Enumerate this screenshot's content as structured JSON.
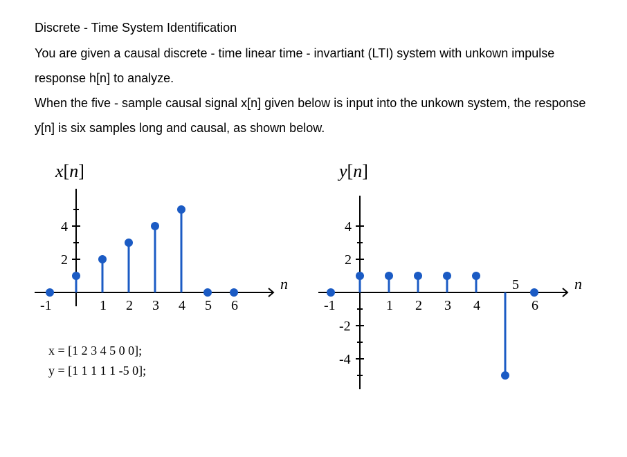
{
  "doc": {
    "title": "Discrete - Time System Identification",
    "p1": "You are given a causal discrete - time linear time - invartiant (LTI) system with unkown impulse response h[n] to analyze.",
    "p2": "When the five - sample causal signal x[n] given below is input into the unkown system, the response y[n] is six samples long and causal, as shown below."
  },
  "left_plot": {
    "label_var": "x",
    "label_index": "n",
    "axis_var": "n",
    "y_ticks": [
      "2",
      "4"
    ],
    "x_ticks": [
      "1",
      "2",
      "3",
      "4",
      "5",
      "6"
    ],
    "neg_x_tick": "-1"
  },
  "right_plot": {
    "label_var": "y",
    "label_index": "n",
    "axis_var": "n",
    "y_ticks_pos": [
      "2",
      "4"
    ],
    "y_ticks_neg": [
      "-2",
      "-4"
    ],
    "x_ticks": [
      "1",
      "2",
      "3",
      "4",
      "5",
      "6"
    ],
    "neg_x_tick": "-1"
  },
  "arrays": {
    "x_line": "x = [1 2 3 4 5 0 0];",
    "y_line": "y = [1 1 1 1 1 -5 0];"
  },
  "chart_data": [
    {
      "type": "stem",
      "title": "x[n]",
      "xlabel": "n",
      "ylabel": "",
      "ylim": [
        -1,
        5
      ],
      "xlim": [
        -1,
        6
      ],
      "series": [
        {
          "name": "x",
          "n": [
            -1,
            0,
            1,
            2,
            3,
            4,
            5,
            6
          ],
          "values": [
            0,
            1,
            2,
            3,
            4,
            5,
            0,
            0
          ]
        }
      ]
    },
    {
      "type": "stem",
      "title": "y[n]",
      "xlabel": "n",
      "ylabel": "",
      "ylim": [
        -5,
        5
      ],
      "xlim": [
        -1,
        6
      ],
      "series": [
        {
          "name": "y",
          "n": [
            -1,
            0,
            1,
            2,
            3,
            4,
            5,
            6
          ],
          "values": [
            0,
            1,
            1,
            1,
            1,
            1,
            -5,
            0
          ]
        }
      ]
    }
  ]
}
